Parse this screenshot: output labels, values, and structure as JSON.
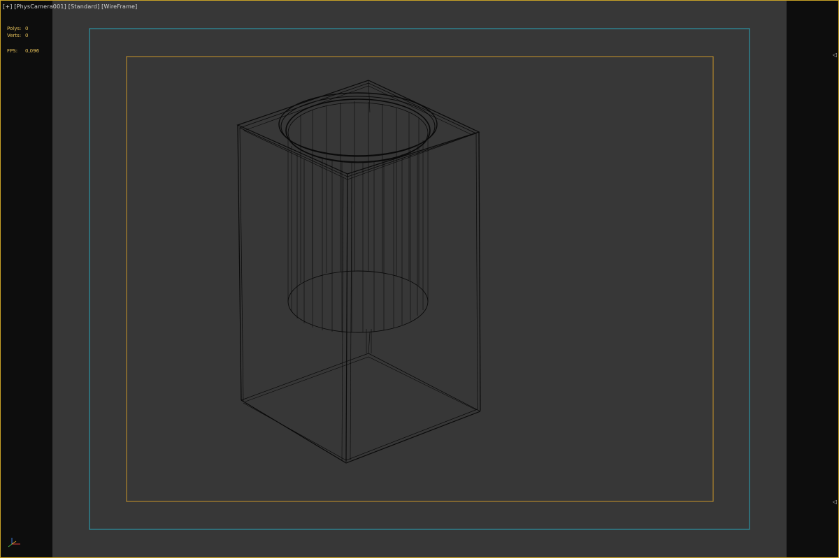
{
  "viewport": {
    "labels": {
      "plus": "[+]",
      "camera": "[PhysCamera001]",
      "shading": "[Standard]",
      "display": "[WireFrame]"
    },
    "stats": {
      "polys_label": "Polys:",
      "polys_value": "0",
      "verts_label": "Verts:",
      "verts_value": "0",
      "fps_label": "FPS:",
      "fps_value": "0,096"
    },
    "markers": {
      "top": "◁",
      "bottom": "◁"
    },
    "icons": {
      "axis_gizmo": "axis-tripod-icon"
    },
    "colors": {
      "safe_frame_outer": "#2aa6b8",
      "safe_frame_inner": "#c9942a",
      "viewport_border": "#c9a227",
      "background": "#373737",
      "wire": "#0a0a0a"
    }
  }
}
